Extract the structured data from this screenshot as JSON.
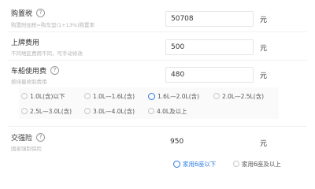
{
  "purchase_tax": {
    "label": "购置税",
    "help": "?",
    "subtitle": "购置附加税=购车型(1+13%)购置率",
    "value": "50708",
    "unit": "元"
  },
  "registration": {
    "label": "上牌费用",
    "subtitle": "不同地区费用不同，可手动修改",
    "value": "500",
    "unit": "元"
  },
  "vehicle_tax": {
    "label": "车船使用费",
    "help": "?",
    "subtitle": "按排量收取费用",
    "value": "480",
    "unit": "元",
    "options": [
      {
        "label": "1.0L(含)以下",
        "selected": false
      },
      {
        "label": "1.0L—1.6L(含)",
        "selected": false
      },
      {
        "label": "1.6L—2.0L(含)",
        "selected": true
      },
      {
        "label": "2.0L—2.5L(含)",
        "selected": false
      },
      {
        "label": "2.5L—3.0L(含)",
        "selected": false
      },
      {
        "label": "3.0L—4.0L(含)",
        "selected": false
      },
      {
        "label": "4.0L及以上",
        "selected": false
      }
    ]
  },
  "compulsory_insurance": {
    "label": "交强险",
    "help": "?",
    "subtitle": "国家强制保险",
    "value": "950",
    "unit": "元",
    "options": [
      {
        "label": "家用6座以下",
        "selected": true
      },
      {
        "label": "家用6座及以上",
        "selected": false
      }
    ]
  },
  "colors": {
    "accent": "#2a7be4"
  }
}
